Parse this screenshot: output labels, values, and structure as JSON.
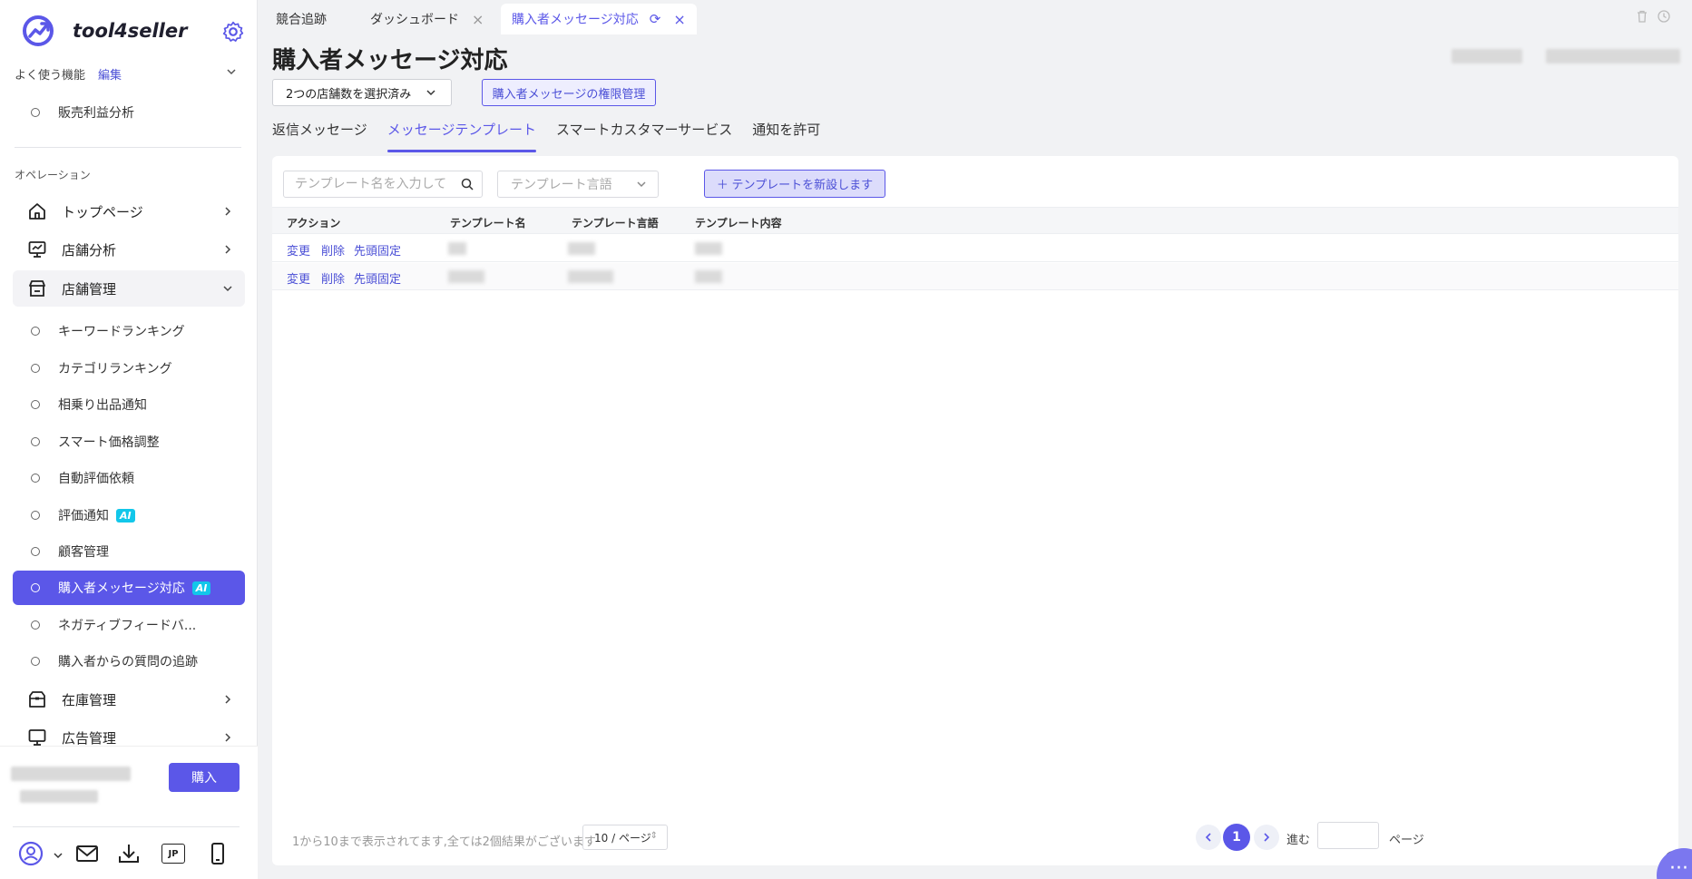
{
  "brand": {
    "name": "tool4seller"
  },
  "sidebar": {
    "favorites_label": "よく使う機能",
    "edit_label": "編集",
    "favorites": [
      {
        "label": "販売利益分析"
      }
    ],
    "section_label": "オペレーション",
    "nav": [
      {
        "label": "トップページ"
      },
      {
        "label": "店舗分析"
      },
      {
        "label": "店舗管理"
      },
      {
        "label": "在庫管理"
      },
      {
        "label": "広告管理"
      }
    ],
    "store_sub": [
      {
        "label": "キーワードランキング"
      },
      {
        "label": "カテゴリランキング"
      },
      {
        "label": "相乗り出品通知"
      },
      {
        "label": "スマート価格調整"
      },
      {
        "label": "自動評価依頼"
      },
      {
        "label": "評価通知"
      },
      {
        "label": "顧客管理"
      },
      {
        "label": "購入者メッセージ対応"
      },
      {
        "label": "ネガティブフィードバ..."
      },
      {
        "label": "購入者からの質問の追跡"
      }
    ],
    "ai_badge": "AI",
    "buy_label": "購入",
    "lang_badge": "JP"
  },
  "tabs": [
    {
      "label": "競合追跡"
    },
    {
      "label": "ダッシュボード"
    },
    {
      "label": "購入者メッセージ対応"
    }
  ],
  "main": {
    "title": "購入者メッセージ対応",
    "store_select": "2つの店舗数を選択済み",
    "permission_button": "購入者メッセージの権限管理",
    "subtabs": [
      {
        "label": "返信メッセージ"
      },
      {
        "label": "メッセージテンプレート"
      },
      {
        "label": "スマートカスタマーサービス"
      },
      {
        "label": "通知を許可"
      }
    ],
    "search_placeholder": "テンプレート名を入力して",
    "lang_placeholder": "テンプレート言語",
    "new_button": "＋ テンプレートを新設します",
    "columns": [
      "アクション",
      "テンプレート名",
      "テンプレート言語",
      "テンプレート内容"
    ],
    "actions": {
      "edit": "変更",
      "delete": "削除",
      "pin": "先頭固定"
    },
    "footer_text": "1から10まで表示されてます,全ては2個結果がございます",
    "page_size": "10 / ページ",
    "current_page": "1",
    "goto_label": "進む",
    "page_label": "ページ"
  },
  "colors": {
    "accent": "#5b57e8",
    "ai_badge": "#12c7ea"
  }
}
